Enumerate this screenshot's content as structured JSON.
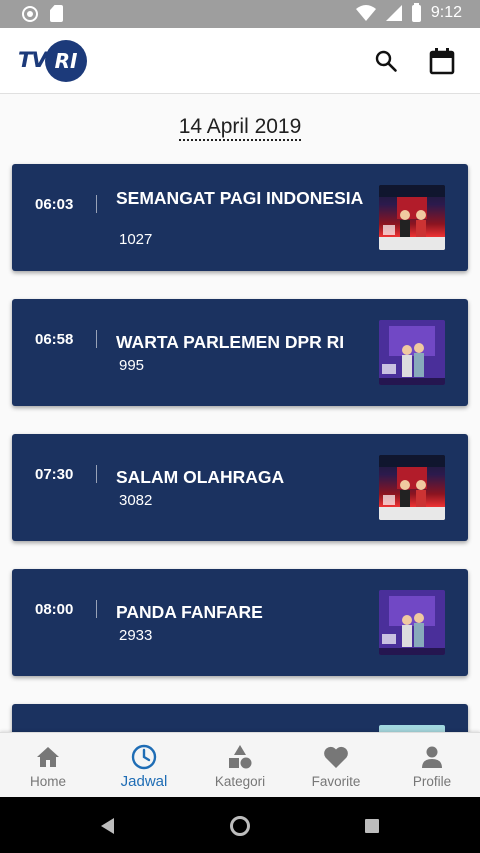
{
  "status_bar": {
    "time": "9:12"
  },
  "app_bar": {
    "logo_tv": "TV",
    "logo_ri": "RI",
    "search_icon": "search-icon",
    "calendar_icon": "calendar-icon"
  },
  "schedule": {
    "date": "14 April 2019",
    "programs": [
      {
        "time": "06:03",
        "title": "SEMANGAT PAGI INDONESIA",
        "count": "1027",
        "thumb": "red"
      },
      {
        "time": "06:58",
        "title": "WARTA PARLEMEN DPR RI",
        "count": "995",
        "thumb": "purple"
      },
      {
        "time": "07:30",
        "title": "SALAM OLAHRAGA",
        "count": "3082",
        "thumb": "red"
      },
      {
        "time": "08:00",
        "title": "PANDA FANFARE",
        "count": "2933",
        "thumb": "purple"
      },
      {
        "time": "",
        "title": "",
        "count": "",
        "thumb": "light"
      }
    ]
  },
  "bottom_nav": {
    "items": [
      {
        "label": "Home",
        "icon": "home-icon"
      },
      {
        "label": "Jadwal",
        "icon": "clock-icon",
        "active": true
      },
      {
        "label": "Kategori",
        "icon": "shapes-icon"
      },
      {
        "label": "Favorite",
        "icon": "heart-icon"
      },
      {
        "label": "Profile",
        "icon": "person-icon"
      }
    ]
  },
  "colors": {
    "card": "#1b3260",
    "brand": "#1c3a7a",
    "active": "#1f6db5",
    "inactive": "#777777"
  }
}
